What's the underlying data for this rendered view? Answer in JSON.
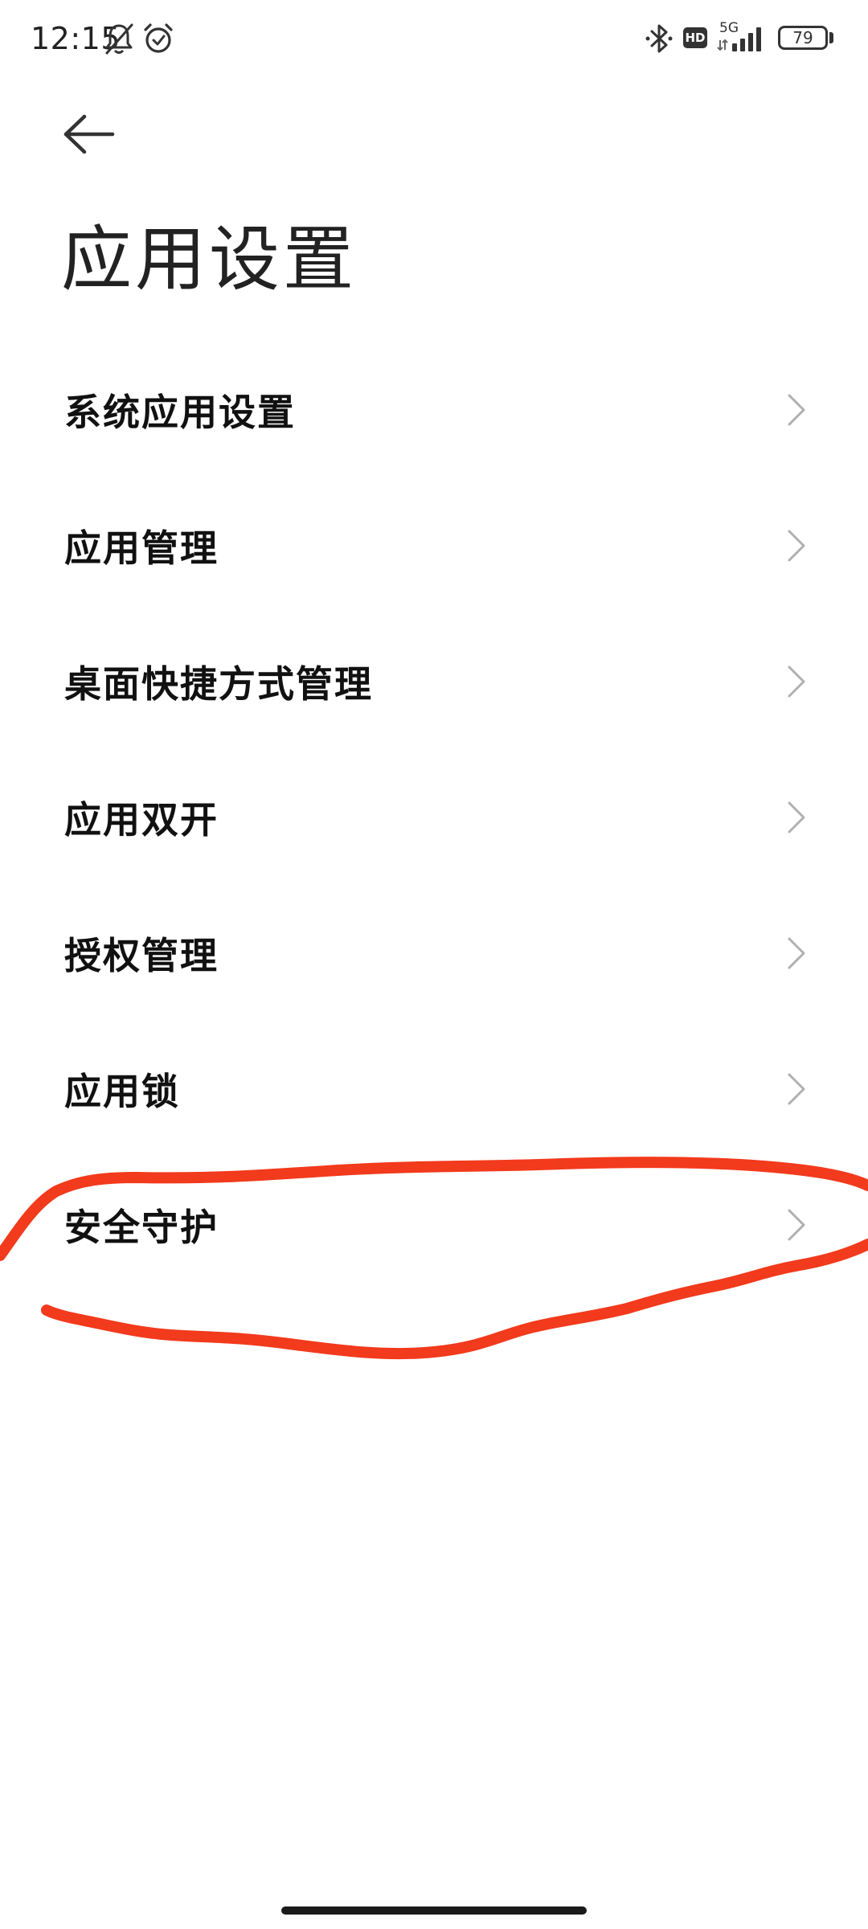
{
  "status_bar": {
    "time": "12:15",
    "network": "5G",
    "hd": "HD",
    "battery": "79"
  },
  "header": {
    "title": "应用设置"
  },
  "settings": {
    "items": [
      {
        "label": "系统应用设置"
      },
      {
        "label": "应用管理"
      },
      {
        "label": "桌面快捷方式管理"
      },
      {
        "label": "应用双开"
      },
      {
        "label": "授权管理"
      },
      {
        "label": "应用锁"
      },
      {
        "label": "安全守护"
      }
    ]
  },
  "annotation": {
    "color": "#f23a1c"
  }
}
